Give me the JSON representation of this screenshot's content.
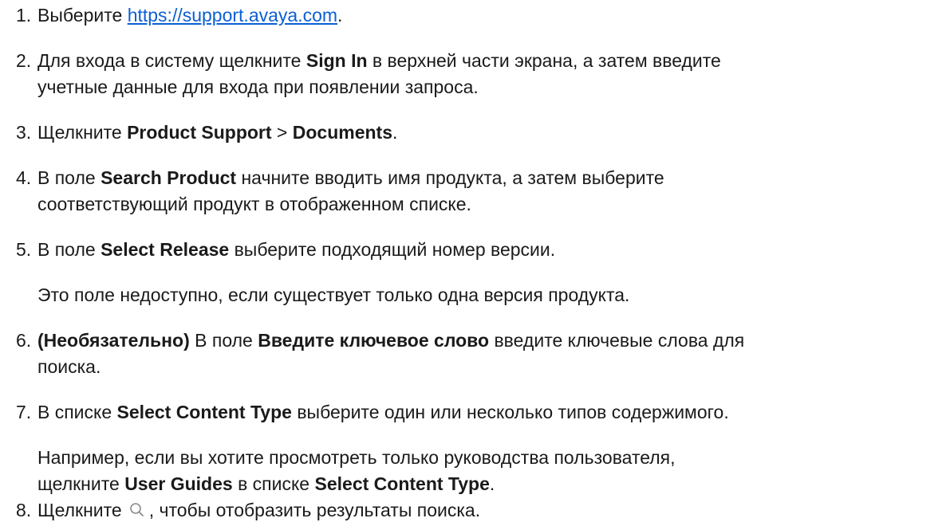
{
  "steps": [
    {
      "num": "1.",
      "pre": "Выберите ",
      "link": "https://support.avaya.com",
      "post": "."
    },
    {
      "num": "2.",
      "line1_pre": "Для входа в систему щелкните ",
      "line1_bold": "Sign In",
      "line1_post": " в верхней части экрана, а затем введите",
      "line2": "учетные данные для входа при появлении запроса."
    },
    {
      "num": "3.",
      "pre": "Щелкните ",
      "bold1": "Product Support",
      "mid": " > ",
      "bold2": "Documents",
      "post": "."
    },
    {
      "num": "4.",
      "line1_pre": "В поле ",
      "line1_bold": "Search Product",
      "line1_post": " начните вводить имя продукта, а затем выберите",
      "line2": "соответствующий продукт в отображенном списке."
    },
    {
      "num": "5.",
      "pre": "В поле ",
      "bold": "Select Release",
      "post": " выберите подходящий номер версии.",
      "note": "Это поле недоступно, если существует только одна версия продукта."
    },
    {
      "num": "6.",
      "line1_bold1": "(Необязательно)",
      "line1_mid": " В поле ",
      "line1_bold2": "Введите ключевое слово",
      "line1_post": " введите ключевые слова для",
      "line2": "поиска."
    },
    {
      "num": "7.",
      "pre": "В списке ",
      "bold": "Select Content Type",
      "post": " выберите один или несколько типов содержимого.",
      "note_line1": "Например, если вы хотите просмотреть только руководства пользователя,",
      "note_line2_pre": "щелкните ",
      "note_line2_bold1": "User Guides",
      "note_line2_mid": " в списке ",
      "note_line2_bold2": "Select Content Type",
      "note_line2_post": "."
    },
    {
      "num": "8.",
      "pre": "Щелкните",
      "icon": "search-icon",
      "post": ", чтобы отобразить результаты поиска."
    }
  ],
  "colors": {
    "text": "#1a1a1a",
    "link": "#0b5fd4",
    "icon": "#8a8a8a"
  }
}
